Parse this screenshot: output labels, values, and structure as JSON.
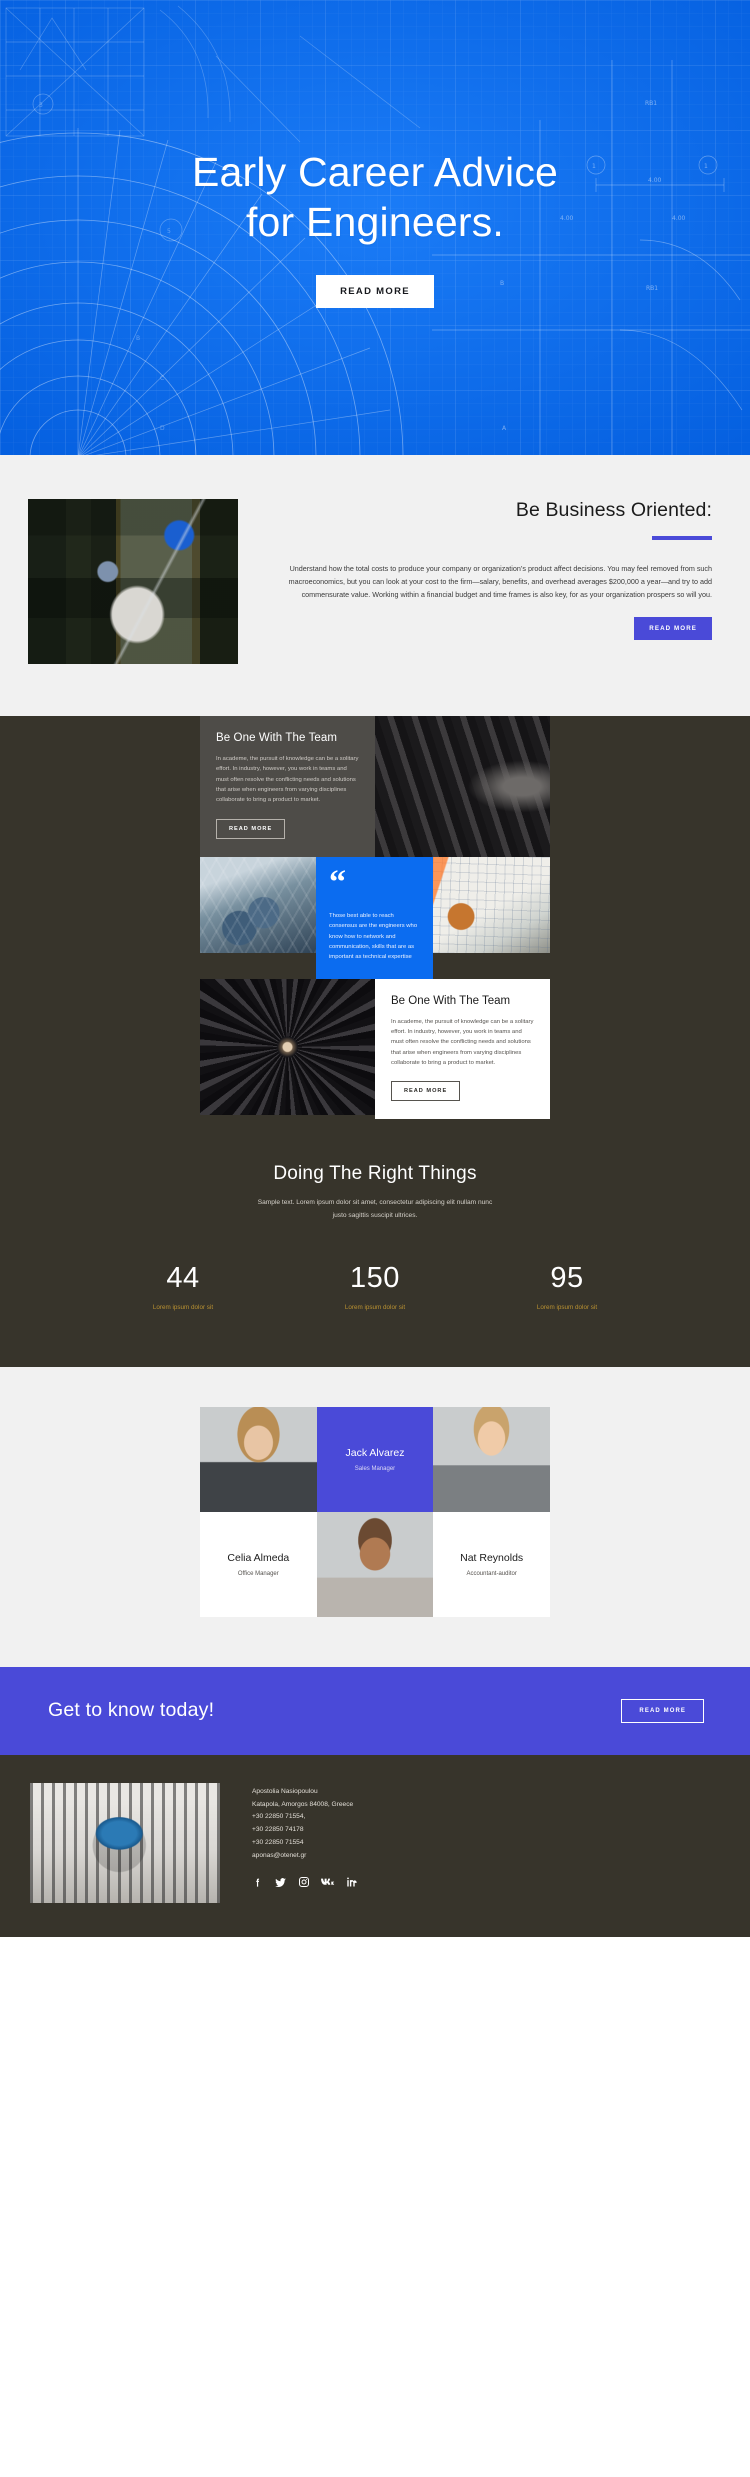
{
  "hero": {
    "title_line1": "Early Career Advice",
    "title_line2": "for Engineers.",
    "cta_label": "READ MORE",
    "bg_color": "#0b6cf0"
  },
  "business": {
    "title": "Be Business Oriented:",
    "body": "Understand how the total costs to produce your company or organization’s product affect decisions. You may feel removed from such macroeconomics, but you can look at your cost to the firm—salary, benefits, and overhead averages $200,000 a year—and try to add commensurate value. Working within a financial budget and time frames is also key, for as your organization prospers so will you.",
    "cta_label": "READ MORE",
    "accent_color": "#4a4ad8",
    "image_alt": "team-overhead-desk-photo"
  },
  "team_feature": {
    "card_top": {
      "title": "Be One With The Team",
      "body": "In academe, the pursuit of knowledge can be a solitary effort. In industry, however, you work in teams and must often resolve the conflicting needs and solutions that arise when engineers from varying disciplines collaborate to bring a product to market.",
      "cta_label": "READ MORE"
    },
    "quote": {
      "mark": "“",
      "text": "Those best able to reach consensus are the engineers who know how to network and communication, skills that are as important as technical expertise",
      "bg_color": "#0b6cf0"
    },
    "card_bottom": {
      "title": "Be One With The Team",
      "body": "In academe, the pursuit of knowledge can be a solitary effort. In industry, however, you work in teams and must often resolve the conflicting needs and solutions that arise when engineers from varying disciplines collaborate to bring a product to market.",
      "cta_label": "READ MORE"
    },
    "images": {
      "turbine_blades": "turbine-blades-photo",
      "hexagon_ceiling": "hexagon-architecture-photo",
      "engineer_drafting": "engineer-blueprint-photo",
      "jet_engine": "jet-engine-fan-photo"
    }
  },
  "stats": {
    "title": "Doing The Right Things",
    "subtitle": "Sample text. Lorem ipsum dolor sit amet, consectetur adipiscing elit nullam nunc justo sagittis suscipit ultrices.",
    "accent_color": "#b99132",
    "items": [
      {
        "value": "44",
        "label": "Lorem ipsum dolor sit"
      },
      {
        "value": "150",
        "label": "Lorem ipsum dolor sit"
      },
      {
        "value": "95",
        "label": "Lorem ipsum dolor sit"
      }
    ]
  },
  "people": {
    "accent_color": "#4a4ad8",
    "members": [
      {
        "name": "Jack Alvarez",
        "role": "Sales Manager"
      },
      {
        "name": "Celia Almeda",
        "role": "Office Manager"
      },
      {
        "name": "Nat Reynolds",
        "role": "Accountant-auditor"
      }
    ]
  },
  "cta_banner": {
    "title": "Get to know today!",
    "cta_label": "READ MORE",
    "bg_color": "#4a4ad8"
  },
  "footer": {
    "image_alt": "crumpled-paper-lightbulb-photo",
    "contact": [
      "Apostolia Nasiopoulou",
      "Katapola, Amorgos 84008, Greece",
      "+30 22850 71554,",
      "+30 22850 74178",
      "+30 22850 71554",
      "aponas@otenet.gr"
    ],
    "socials": [
      "facebook-icon",
      "twitter-icon",
      "instagram-icon",
      "vk-icon",
      "linkedin-icon"
    ],
    "bg_color": "#37342b"
  }
}
